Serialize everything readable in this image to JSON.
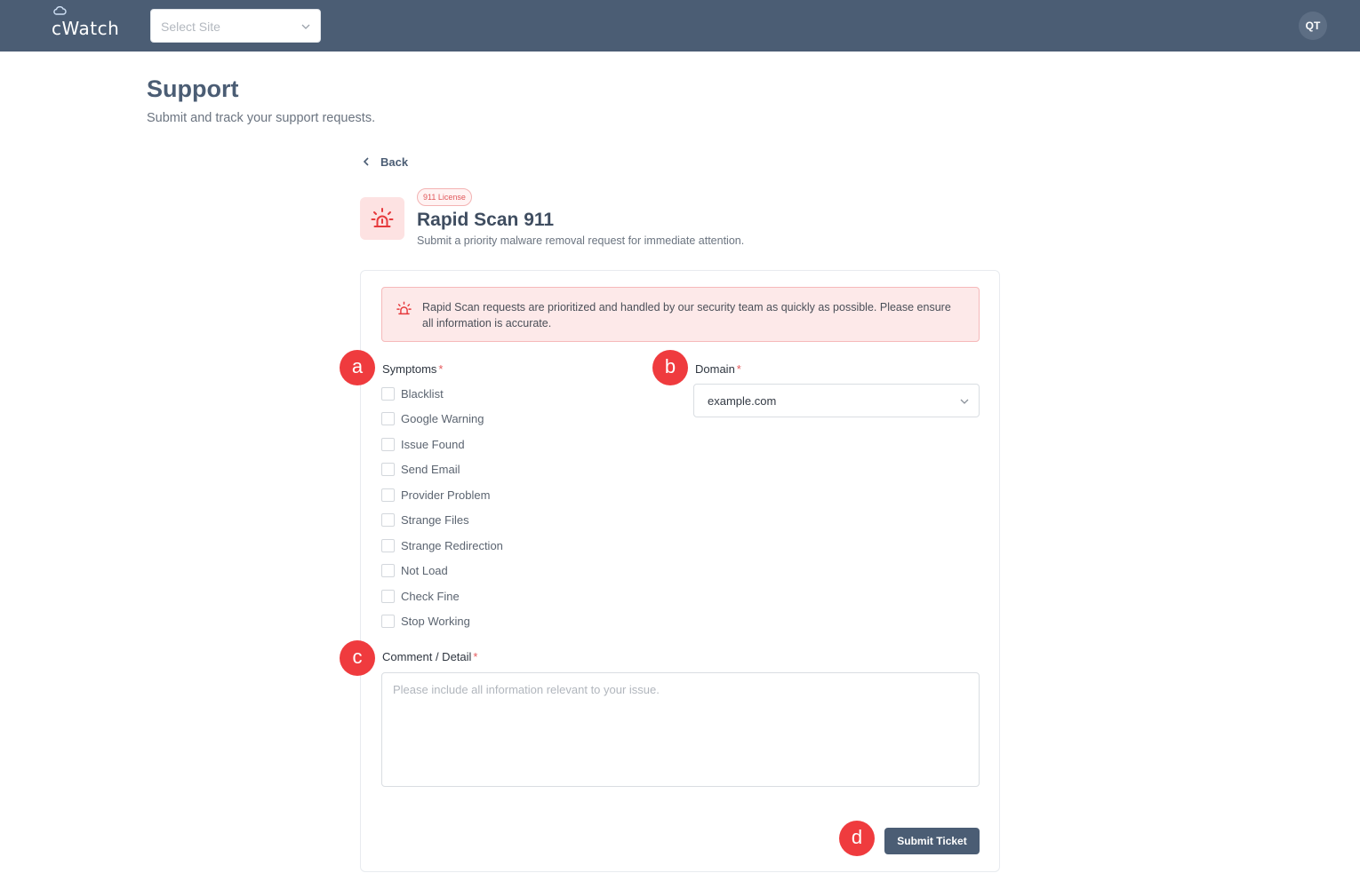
{
  "app": {
    "logo_text": "cWatch",
    "user_initials": "QT"
  },
  "header": {
    "site_select_placeholder": "Select Site"
  },
  "page": {
    "title": "Support",
    "subtitle": "Submit and track your support requests."
  },
  "nav": {
    "back_label": "Back"
  },
  "service": {
    "badge": "911 License",
    "title": "Rapid Scan 911",
    "subtitle": "Submit a priority malware removal request for immediate attention.",
    "icon": "alarm-light-icon"
  },
  "alert": {
    "text": "Rapid Scan requests are prioritized and handled by our security team as quickly as possible. Please ensure all information is accurate."
  },
  "form": {
    "symptoms_label": "Symptoms",
    "required_mark": "*",
    "symptoms": [
      "Blacklist",
      "Google Warning",
      "Issue Found",
      "Send Email",
      "Provider Problem",
      "Strange Files",
      "Strange Redirection",
      "Not Load",
      "Check Fine",
      "Stop Working"
    ],
    "domain_label": "Domain",
    "domain_value": "example.com",
    "comment_label": "Comment / Detail",
    "comment_placeholder": "Please include all information relevant to your issue.",
    "submit_label": "Submit Ticket"
  },
  "markers": [
    "a",
    "b",
    "c",
    "d"
  ],
  "colors": {
    "topbar": "#4b5d74",
    "accent_red": "#ef3b3e",
    "alert_bg": "#fde9e9",
    "button": "#4b5d74"
  }
}
